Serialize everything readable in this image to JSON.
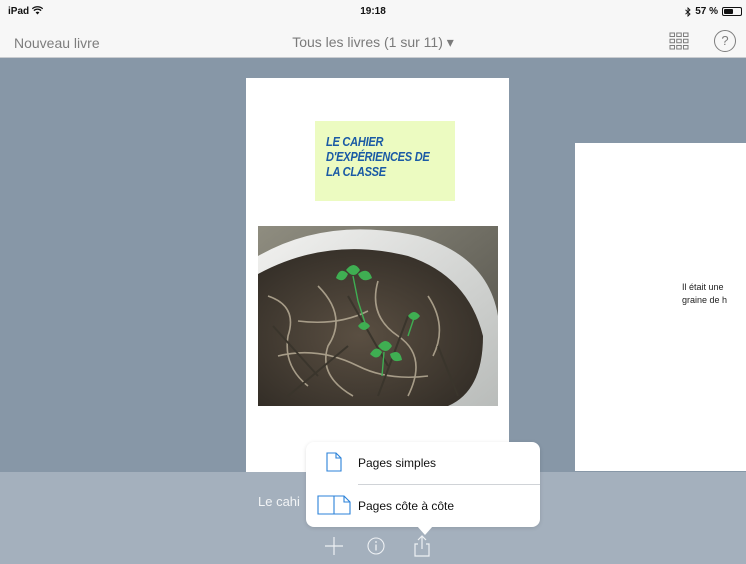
{
  "status": {
    "carrier": "iPad",
    "time": "19:18",
    "bluetooth": "bluetooth-icon",
    "battery_text": "57 %",
    "battery_level": 0.57
  },
  "nav": {
    "left_button": "Nouveau livre",
    "title": "Tous les livres (1 sur 11) ▾",
    "help_label": "?"
  },
  "cover": {
    "title": "Le cahier d'expériences de la classe",
    "title_bg": "#ecfbc1",
    "title_color": "#1a5aa5",
    "photo": "plant-seedling-photo"
  },
  "page_two": {
    "text_line1": "Il était une",
    "text_line2": "graine de h"
  },
  "bottom": {
    "book_title": "Le cahi",
    "add_icon": "plus-icon",
    "info_icon": "info-icon",
    "share_icon": "share-icon"
  },
  "popover": {
    "items": [
      {
        "label": "Pages simples",
        "icon": "single-page-icon"
      },
      {
        "label": "Pages côte à côte",
        "icon": "double-page-icon"
      }
    ]
  },
  "colors": {
    "background": "#8797a7",
    "bottom_bar": "#a4b0bd",
    "bars": "#f7f7f7",
    "accent": "#1a5aa5"
  }
}
